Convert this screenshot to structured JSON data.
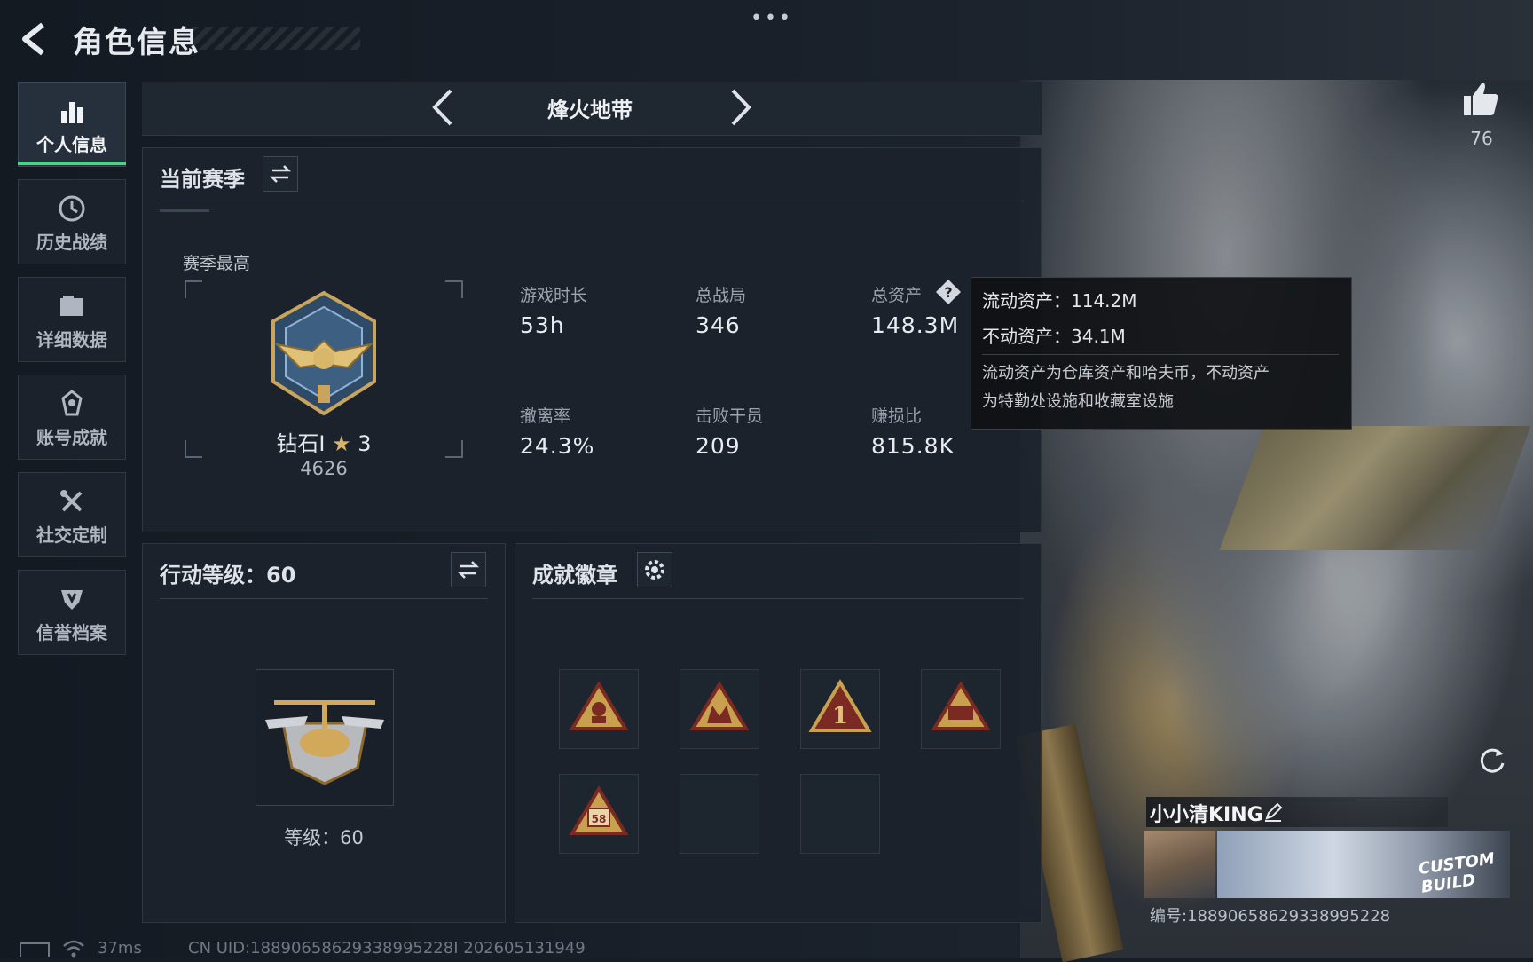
{
  "header": {
    "title": "角色信息"
  },
  "sidebar": {
    "items": [
      {
        "label": "个人信息",
        "icon": "bar-chart-icon"
      },
      {
        "label": "历史战绩",
        "icon": "history-icon"
      },
      {
        "label": "详细数据",
        "icon": "folder-icon"
      },
      {
        "label": "账号成就",
        "icon": "achievement-icon"
      },
      {
        "label": "社交定制",
        "icon": "tools-icon"
      },
      {
        "label": "信誉档案",
        "icon": "credit-shield-icon"
      }
    ]
  },
  "mode": {
    "name": "烽火地带"
  },
  "season": {
    "title": "当前赛季",
    "highest_label": "赛季最高",
    "rank_name": "钻石Ⅰ",
    "rank_stars": "3",
    "rank_points": "4626",
    "stats": [
      {
        "label": "游戏时长",
        "value": "53h"
      },
      {
        "label": "总战局",
        "value": "346"
      },
      {
        "label": "总资产",
        "value": "148.3M"
      },
      {
        "label": "撤离率",
        "value": "24.3%"
      },
      {
        "label": "击败干员",
        "value": "209"
      },
      {
        "label": "赚损比",
        "value": "815.8K"
      }
    ]
  },
  "tooltip": {
    "liquid": "流动资产：114.2M",
    "fixed": "不动资产：34.1M",
    "desc_line1": "流动资产为仓库资产和哈夫币，不动资产",
    "desc_line2": "为特勤处设施和收藏室设施"
  },
  "action_level": {
    "title": "行动等级：60",
    "level_text": "等级：60"
  },
  "badges": {
    "title": "成就徽章",
    "badge5_text": "58"
  },
  "player": {
    "likes": "76",
    "name": "小小清KING",
    "id": "编号:18890658629338995228",
    "banner_text": "CUSTOM BUILD"
  },
  "footer": {
    "ping": "37ms",
    "uid": "CN UID:18890658629338995228I 202605131949"
  }
}
